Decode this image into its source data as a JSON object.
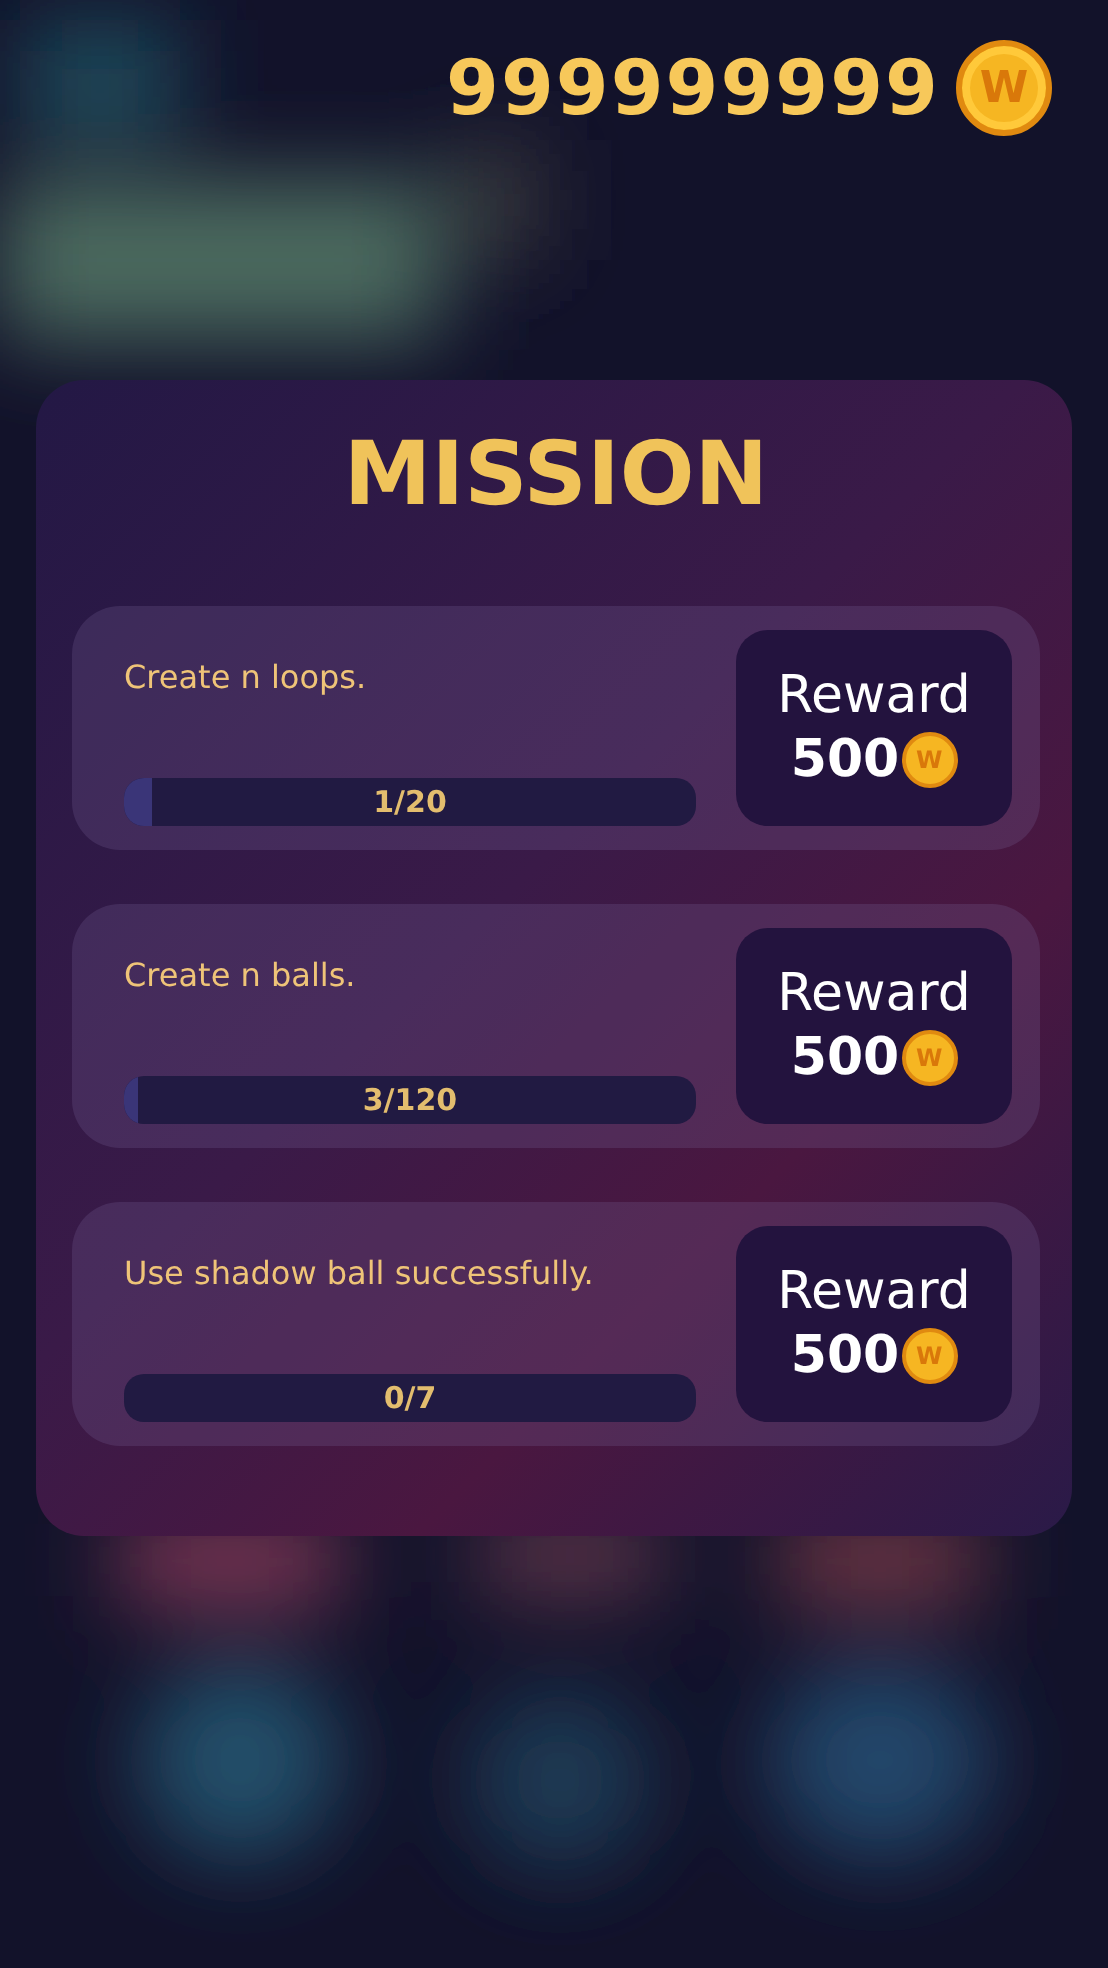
{
  "balance": {
    "amount": "999999999",
    "coin_letter": "W"
  },
  "panel": {
    "title": "MISSION"
  },
  "missions": [
    {
      "description": "Create n loops.",
      "progress": "1/20",
      "level": 0.05,
      "reward_label": "Reward",
      "reward_amount": "500",
      "coin_letter": "W"
    },
    {
      "description": "Create n balls.",
      "progress": "3/120",
      "level": 0.025,
      "reward_label": "Reward",
      "reward_amount": "500",
      "coin_letter": "W"
    },
    {
      "description": "Use shadow ball successfully.",
      "progress": "0/7",
      "reward_label": "Reward",
      "reward_amount": "500",
      "coin_letter": "W"
    }
  ]
}
